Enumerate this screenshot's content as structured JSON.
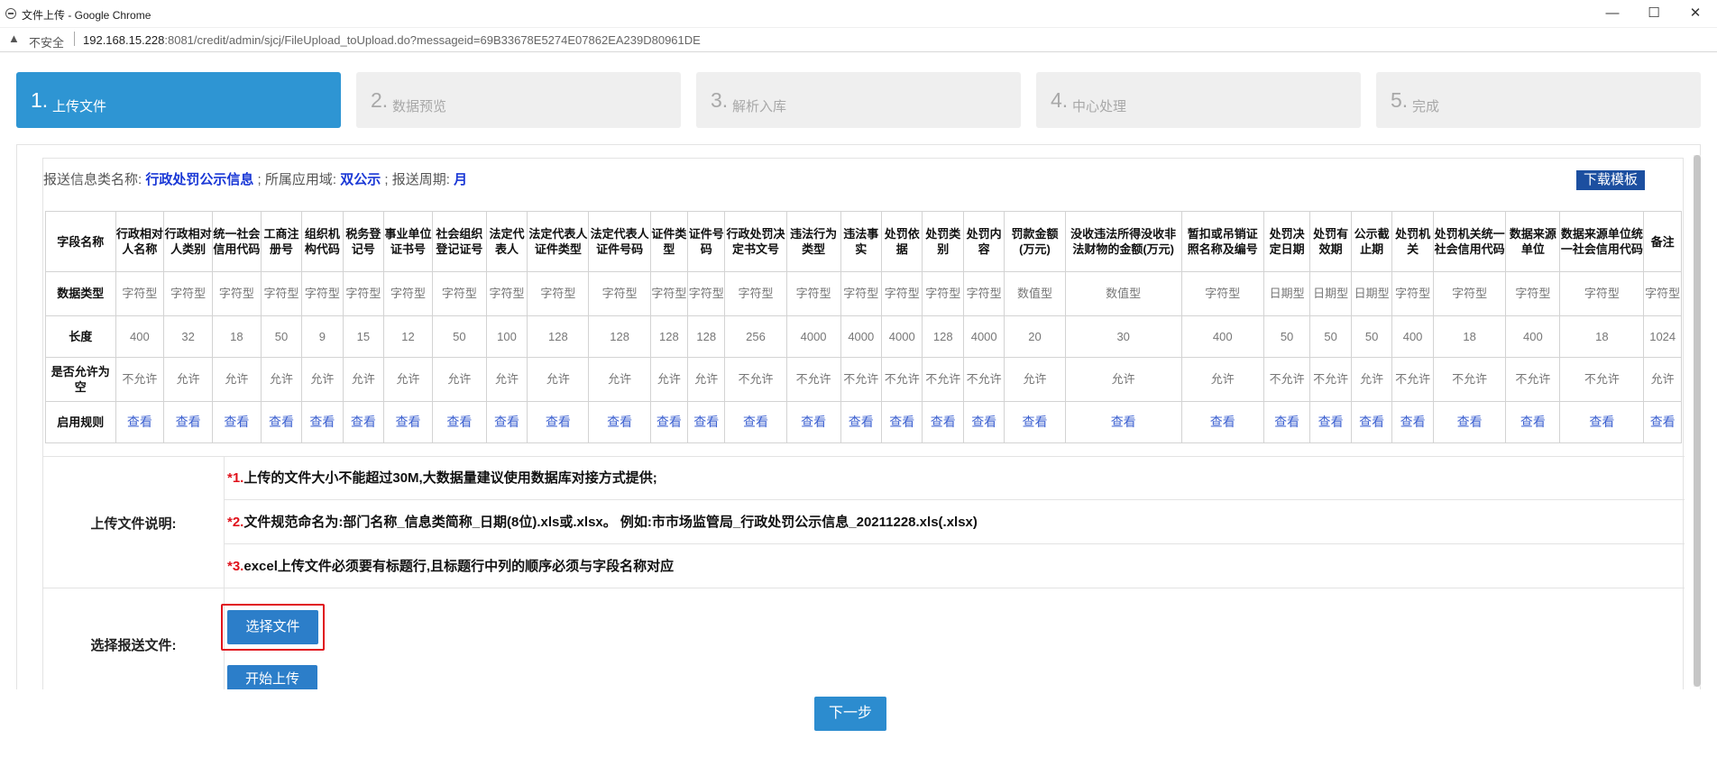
{
  "window": {
    "title": "文件上传 - Google Chrome",
    "minimize": "—",
    "maximize": "☐",
    "close": "✕"
  },
  "address": {
    "insecure": "不安全",
    "host": "192.168.15.228",
    "path": ":8081/credit/admin/sjcj/FileUpload_toUpload.do?messageid=69B33678E5274E07862EA239D80961DE"
  },
  "steps": [
    {
      "num": "1.",
      "label": "上传文件"
    },
    {
      "num": "2.",
      "label": "数据预览"
    },
    {
      "num": "3.",
      "label": "解析入库"
    },
    {
      "num": "4.",
      "label": "中心处理"
    },
    {
      "num": "5.",
      "label": "完成"
    }
  ],
  "info": {
    "type_label": "报送信息类名称:",
    "type_value": "行政处罚公示信息",
    "domain_label": "; 所属应用域:",
    "domain_value": "双公示",
    "period_label": "; 报送周期:",
    "period_value": "月",
    "download_btn": "下载模板"
  },
  "table": {
    "row_labels": [
      "字段名称",
      "数据类型",
      "长度",
      "是否允许为空",
      "启用规则"
    ],
    "columns": [
      {
        "name": "行政相对人名称",
        "type": "字符型",
        "len": "400",
        "null": "不允许"
      },
      {
        "name": "行政相对人类别",
        "type": "字符型",
        "len": "32",
        "null": "允许"
      },
      {
        "name": "统一社会信用代码",
        "type": "字符型",
        "len": "18",
        "null": "允许"
      },
      {
        "name": "工商注册号",
        "type": "字符型",
        "len": "50",
        "null": "允许"
      },
      {
        "name": "组织机构代码",
        "type": "字符型",
        "len": "9",
        "null": "允许"
      },
      {
        "name": "税务登记号",
        "type": "字符型",
        "len": "15",
        "null": "允许"
      },
      {
        "name": "事业单位证书号",
        "type": "字符型",
        "len": "12",
        "null": "允许"
      },
      {
        "name": "社会组织登记证号",
        "type": "字符型",
        "len": "50",
        "null": "允许"
      },
      {
        "name": "法定代表人",
        "type": "字符型",
        "len": "100",
        "null": "允许"
      },
      {
        "name": "法定代表人证件类型",
        "type": "字符型",
        "len": "128",
        "null": "允许"
      },
      {
        "name": "法定代表人证件号码",
        "type": "字符型",
        "len": "128",
        "null": "允许"
      },
      {
        "name": "证件类型",
        "type": "字符型",
        "len": "128",
        "null": "允许"
      },
      {
        "name": "证件号码",
        "type": "字符型",
        "len": "128",
        "null": "允许"
      },
      {
        "name": "行政处罚决定书文号",
        "type": "字符型",
        "len": "256",
        "null": "不允许"
      },
      {
        "name": "违法行为类型",
        "type": "字符型",
        "len": "4000",
        "null": "不允许"
      },
      {
        "name": "违法事实",
        "type": "字符型",
        "len": "4000",
        "null": "不允许"
      },
      {
        "name": "处罚依据",
        "type": "字符型",
        "len": "4000",
        "null": "不允许"
      },
      {
        "name": "处罚类别",
        "type": "字符型",
        "len": "128",
        "null": "不允许"
      },
      {
        "name": "处罚内容",
        "type": "字符型",
        "len": "4000",
        "null": "不允许"
      },
      {
        "name": "罚款金额(万元)",
        "type": "数值型",
        "len": "20",
        "null": "允许"
      },
      {
        "name": "没收违法所得没收非法财物的金额(万元)",
        "type": "数值型",
        "len": "30",
        "null": "允许"
      },
      {
        "name": "暂扣或吊销证照名称及编号",
        "type": "字符型",
        "len": "400",
        "null": "允许"
      },
      {
        "name": "处罚决定日期",
        "type": "日期型",
        "len": "50",
        "null": "不允许"
      },
      {
        "name": "处罚有效期",
        "type": "日期型",
        "len": "50",
        "null": "不允许"
      },
      {
        "name": "公示截止期",
        "type": "日期型",
        "len": "50",
        "null": "允许"
      },
      {
        "name": "处罚机关",
        "type": "字符型",
        "len": "400",
        "null": "不允许"
      },
      {
        "name": "处罚机关统一社会信用代码",
        "type": "字符型",
        "len": "18",
        "null": "不允许"
      },
      {
        "name": "数据来源单位",
        "type": "字符型",
        "len": "400",
        "null": "不允许"
      },
      {
        "name": "数据来源单位统一社会信用代码",
        "type": "字符型",
        "len": "18",
        "null": "不允许"
      },
      {
        "name": "备注",
        "type": "字符型",
        "len": "1024",
        "null": "允许"
      }
    ],
    "view_label": "查看"
  },
  "upload_desc": {
    "label": "上传文件说明:",
    "lines": [
      {
        "n": "*1.",
        "text": "上传的文件大小不能超过30M,大数据量建议使用数据库对接方式提供;"
      },
      {
        "n": "*2.",
        "text": "文件规范命名为:部门名称_信息类简称_日期(8位).xls或.xlsx。 例如:市市场监管局_行政处罚公示信息_20211228.xls(.xlsx)"
      },
      {
        "n": "*3.",
        "text": "excel上传文件必须要有标题行,且标题行中列的顺序必须与字段名称对应"
      }
    ]
  },
  "choose": {
    "label": "选择报送文件:",
    "choose_btn": "选择文件",
    "upload_btn": "开始上传"
  },
  "next_btn": "下一步",
  "colors": {
    "active_step": "#2e95d3",
    "inactive_step": "#efefef",
    "info_value": "#1a38d6",
    "download_btn": "#1c4fa0",
    "highlight_box": "#e0121b"
  }
}
